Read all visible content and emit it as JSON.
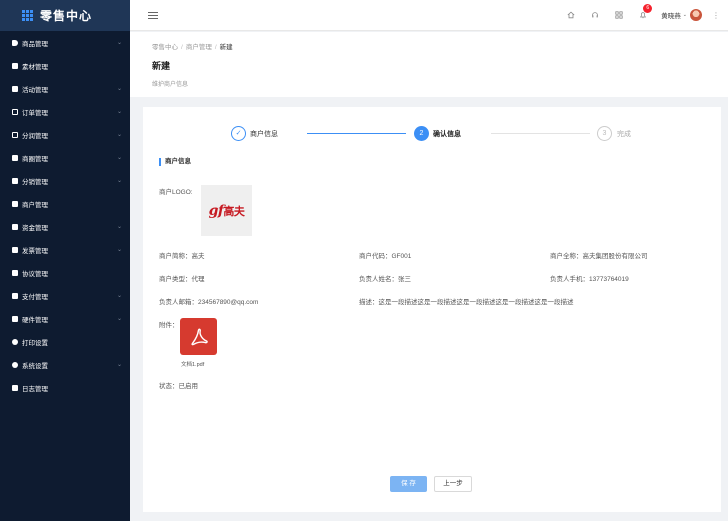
{
  "app": {
    "title": "零售中心"
  },
  "sidebar": {
    "items": [
      {
        "label": "商品管理",
        "icon": "tag-icon",
        "chevron": true
      },
      {
        "label": "素材管理",
        "icon": "file-icon",
        "chevron": false
      },
      {
        "label": "活动管理",
        "icon": "calendar-icon",
        "chevron": true
      },
      {
        "label": "订单管理",
        "icon": "order-icon",
        "chevron": true
      },
      {
        "label": "分润管理",
        "icon": "share-icon",
        "chevron": true
      },
      {
        "label": "商圈管理",
        "icon": "grid-icon",
        "chevron": true
      },
      {
        "label": "分销管理",
        "icon": "home-icon",
        "chevron": true
      },
      {
        "label": "商户管理",
        "icon": "merchant-icon",
        "chevron": false
      },
      {
        "label": "资金管理",
        "icon": "wallet-icon",
        "chevron": true
      },
      {
        "label": "发票管理",
        "icon": "invoice-icon",
        "chevron": true
      },
      {
        "label": "协议管理",
        "icon": "contract-icon",
        "chevron": false
      },
      {
        "label": "支付管理",
        "icon": "card-icon",
        "chevron": true
      },
      {
        "label": "硬件管理",
        "icon": "device-icon",
        "chevron": true
      },
      {
        "label": "打印设置",
        "icon": "printer-icon",
        "chevron": false
      },
      {
        "label": "系统设置",
        "icon": "gear-icon",
        "chevron": true
      },
      {
        "label": "日志管理",
        "icon": "log-icon",
        "chevron": false
      }
    ],
    "chevron_glyph": "⌄"
  },
  "topbar": {
    "notification_count": "6",
    "user_name": "黄晓燕",
    "caret": "⌄",
    "more": "⋮",
    "icons": [
      "home-icon",
      "headset-icon",
      "apps-icon",
      "bell-icon"
    ]
  },
  "breadcrumb": {
    "items": [
      "零售中心",
      "商户管理",
      "新建"
    ],
    "separator": "/"
  },
  "page": {
    "title": "新建",
    "subtitle": "维护商户信息"
  },
  "steps": [
    {
      "marker": "✓",
      "label": "商户信息",
      "state": "done"
    },
    {
      "marker": "2",
      "label": "确认信息",
      "state": "active"
    },
    {
      "marker": "3",
      "label": "完成",
      "state": "todo"
    }
  ],
  "section": {
    "title": "商户信息"
  },
  "logo": {
    "label": "商户LOGO:",
    "brand_mark": "gf",
    "brand_name": "高夫"
  },
  "fields": {
    "short_name": "商户简称：高夫",
    "code": "商户代码：GF001",
    "full_name": "商户全称：高夫集团股份有限公司",
    "type": "商户类型：代理",
    "contact_name": "负责人姓名：张三",
    "contact_phone": "负责人手机：13773764019",
    "contact_email": "负责人邮箱：234567890@qq.com",
    "description": "描述：这是一段描述这是一段描述这是一段描述这是一段描述这是一段描述",
    "attachment_label": "附件：",
    "status": "状态：已启用"
  },
  "attachment": {
    "file_name": "文档1.pdf",
    "icon": "pdf-icon"
  },
  "colors": {
    "primary": "#3c8ff5",
    "sidebar": "#0e1b30",
    "pdf": "#d63a2f",
    "brand": "#c61a22"
  },
  "buttons": {
    "save": "保 存",
    "prev": "上一步"
  }
}
